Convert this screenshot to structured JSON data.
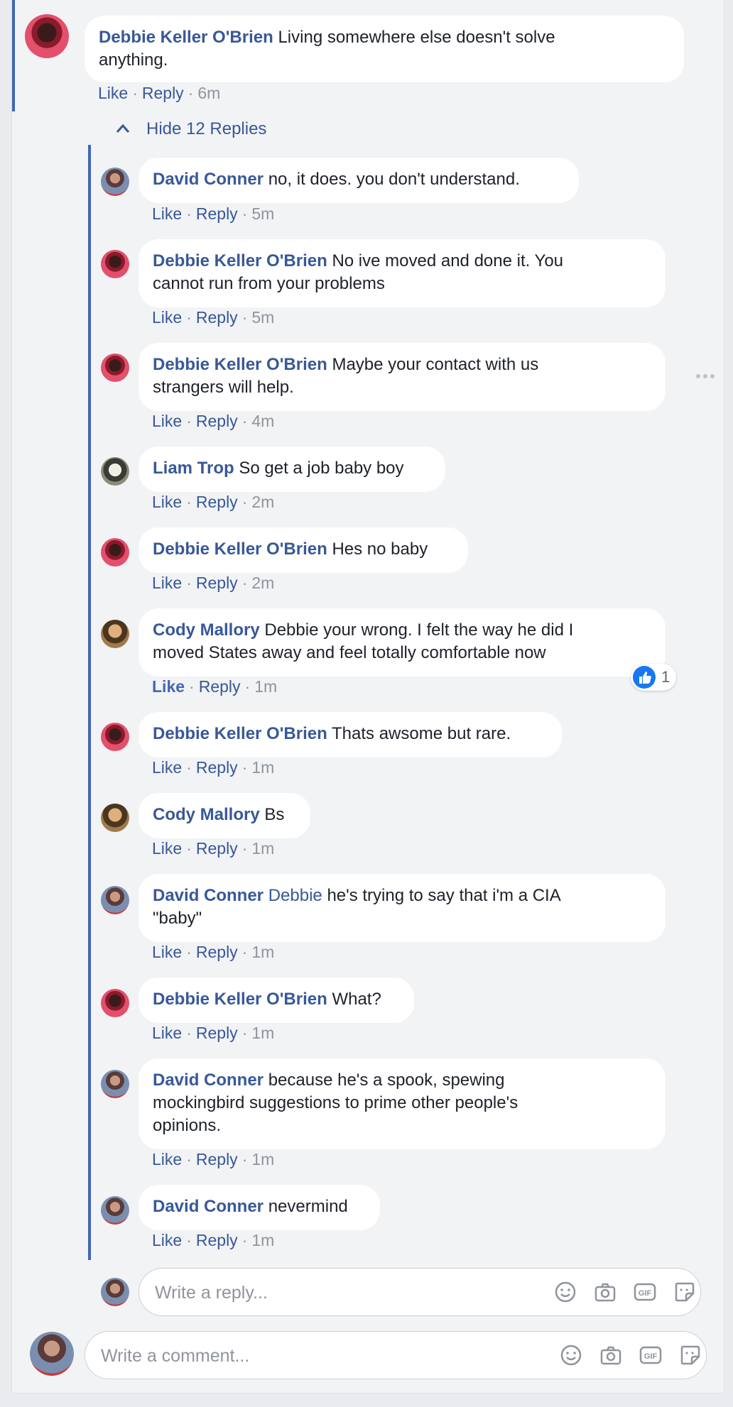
{
  "thread": {
    "top_comment": {
      "author": "Debbie Keller O'Brien",
      "text_line1": "Living somewhere else doesn't solve",
      "text_line2": "anything.",
      "like": "Like",
      "reply": "Reply",
      "time": "6m"
    },
    "hide_replies_label": "Hide 12 Replies",
    "replies": [
      {
        "author": "David Conner",
        "text": "no, it does. you don't understand.",
        "time": "5m"
      },
      {
        "author": "Debbie Keller O'Brien",
        "text": "No ive moved and done it. You",
        "text2": "cannot run from your problems",
        "time": "5m"
      },
      {
        "author": "Debbie Keller O'Brien",
        "text": "Maybe your contact with us",
        "text2": "strangers will help.",
        "time": "4m"
      },
      {
        "author": "Liam Trop",
        "text": "So get a job baby boy",
        "time": "2m"
      },
      {
        "author": "Debbie Keller O'Brien",
        "text": "Hes no baby",
        "time": "2m"
      },
      {
        "author": "Cody Mallory",
        "text": "Debbie your wrong. I felt the way he did I",
        "text2": "moved States away and feel totally comfortable now",
        "time": "1m",
        "reaction_count": "1"
      },
      {
        "author": "Debbie Keller O'Brien",
        "text": "Thats awsome but rare.",
        "time": "1m"
      },
      {
        "author": "Cody Mallory",
        "text": "Bs",
        "time": "1m"
      },
      {
        "author": "David Conner",
        "mention": "Debbie",
        "text": "he's trying to say that i'm a CIA",
        "text2": "\"baby\"",
        "time": "1m"
      },
      {
        "author": "Debbie Keller O'Brien",
        "text": "What?",
        "time": "1m"
      },
      {
        "author": "David Conner",
        "text": "because he's a spook, spewing",
        "text2": "mockingbird suggestions to prime other people's",
        "text3": "opinions.",
        "time": "1m"
      },
      {
        "author": "David Conner",
        "text": "nevermind",
        "time": "1m"
      }
    ],
    "like_label": "Like",
    "reply_label": "Reply",
    "reply_input_placeholder": "Write a reply...",
    "comment_input_placeholder": "Write a comment..."
  },
  "icons": [
    "more-options-icon",
    "chevron-up-icon",
    "like-reaction-icon",
    "emoji-icon",
    "camera-icon",
    "gif-icon",
    "sticker-icon"
  ],
  "colors": {
    "accent": "#4267b2",
    "name_link": "#385898",
    "meta": "#90949c",
    "bubble": "#ffffff",
    "background": "#f2f3f5"
  }
}
